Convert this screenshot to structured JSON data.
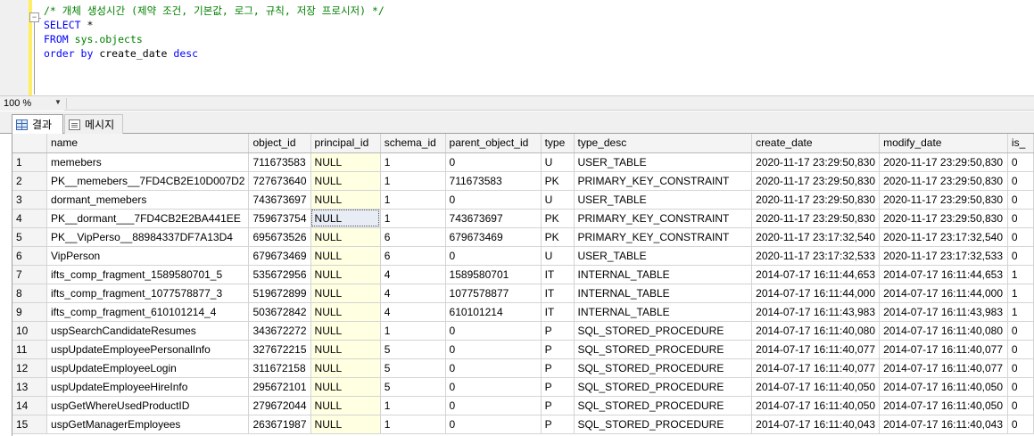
{
  "editor": {
    "lines": [
      {
        "parts": [
          {
            "cls": "c-comment",
            "text": "/* 개체 생성시간 (제약 조건, 기본값, 로그, 규칙, 저장 프로시저) */"
          }
        ]
      },
      {
        "parts": [
          {
            "cls": "c-kw",
            "text": "SELECT"
          },
          {
            "cls": "c-id",
            "text": " *"
          }
        ]
      },
      {
        "parts": [
          {
            "cls": "c-kw",
            "text": "FROM"
          },
          {
            "cls": "c-id",
            "text": " "
          },
          {
            "cls": "c-obj",
            "text": "sys.objects"
          }
        ]
      },
      {
        "parts": [
          {
            "cls": "c-kw",
            "text": "order by"
          },
          {
            "cls": "c-id",
            "text": " create_date "
          },
          {
            "cls": "c-kw",
            "text": "desc"
          }
        ]
      }
    ]
  },
  "zoom": {
    "value": "100 %"
  },
  "tabs": {
    "results_label": "결과",
    "messages_label": "메시지"
  },
  "grid": {
    "columns": [
      "name",
      "object_id",
      "principal_id",
      "schema_id",
      "parent_object_id",
      "type",
      "type_desc",
      "create_date",
      "modify_date",
      "is_"
    ],
    "rows": [
      [
        "1",
        "memebers",
        "711673583",
        "NULL",
        "1",
        "0",
        "U",
        "USER_TABLE",
        "2020-11-17 23:29:50,830",
        "2020-11-17 23:29:50,830",
        "0"
      ],
      [
        "2",
        "PK__memebers__7FD4CB2E10D007D2",
        "727673640",
        "NULL",
        "1",
        "711673583",
        "PK",
        "PRIMARY_KEY_CONSTRAINT",
        "2020-11-17 23:29:50,830",
        "2020-11-17 23:29:50,830",
        "0"
      ],
      [
        "3",
        "dormant_memebers",
        "743673697",
        "NULL",
        "1",
        "0",
        "U",
        "USER_TABLE",
        "2020-11-17 23:29:50,830",
        "2020-11-17 23:29:50,830",
        "0"
      ],
      [
        "4",
        "PK__dormant___7FD4CB2E2BA441EE",
        "759673754",
        "NULL",
        "1",
        "743673697",
        "PK",
        "PRIMARY_KEY_CONSTRAINT",
        "2020-11-17 23:29:50,830",
        "2020-11-17 23:29:50,830",
        "0"
      ],
      [
        "5",
        "PK__VipPerso__88984337DF7A13D4",
        "695673526",
        "NULL",
        "6",
        "679673469",
        "PK",
        "PRIMARY_KEY_CONSTRAINT",
        "2020-11-17 23:17:32,540",
        "2020-11-17 23:17:32,540",
        "0"
      ],
      [
        "6",
        "VipPerson",
        "679673469",
        "NULL",
        "6",
        "0",
        "U",
        "USER_TABLE",
        "2020-11-17 23:17:32,533",
        "2020-11-17 23:17:32,533",
        "0"
      ],
      [
        "7",
        "ifts_comp_fragment_1589580701_5",
        "535672956",
        "NULL",
        "4",
        "1589580701",
        "IT",
        "INTERNAL_TABLE",
        "2014-07-17 16:11:44,653",
        "2014-07-17 16:11:44,653",
        "1"
      ],
      [
        "8",
        "ifts_comp_fragment_1077578877_3",
        "519672899",
        "NULL",
        "4",
        "1077578877",
        "IT",
        "INTERNAL_TABLE",
        "2014-07-17 16:11:44,000",
        "2014-07-17 16:11:44,000",
        "1"
      ],
      [
        "9",
        "ifts_comp_fragment_610101214_4",
        "503672842",
        "NULL",
        "4",
        "610101214",
        "IT",
        "INTERNAL_TABLE",
        "2014-07-17 16:11:43,983",
        "2014-07-17 16:11:43,983",
        "1"
      ],
      [
        "10",
        "uspSearchCandidateResumes",
        "343672272",
        "NULL",
        "1",
        "0",
        "P",
        "SQL_STORED_PROCEDURE",
        "2014-07-17 16:11:40,080",
        "2014-07-17 16:11:40,080",
        "0"
      ],
      [
        "11",
        "uspUpdateEmployeePersonalInfo",
        "327672215",
        "NULL",
        "5",
        "0",
        "P",
        "SQL_STORED_PROCEDURE",
        "2014-07-17 16:11:40,077",
        "2014-07-17 16:11:40,077",
        "0"
      ],
      [
        "12",
        "uspUpdateEmployeeLogin",
        "311672158",
        "NULL",
        "5",
        "0",
        "P",
        "SQL_STORED_PROCEDURE",
        "2014-07-17 16:11:40,077",
        "2014-07-17 16:11:40,077",
        "0"
      ],
      [
        "13",
        "uspUpdateEmployeeHireInfo",
        "295672101",
        "NULL",
        "5",
        "0",
        "P",
        "SQL_STORED_PROCEDURE",
        "2014-07-17 16:11:40,050",
        "2014-07-17 16:11:40,050",
        "0"
      ],
      [
        "14",
        "uspGetWhereUsedProductID",
        "279672044",
        "NULL",
        "1",
        "0",
        "P",
        "SQL_STORED_PROCEDURE",
        "2014-07-17 16:11:40,050",
        "2014-07-17 16:11:40,050",
        "0"
      ],
      [
        "15",
        "uspGetManagerEmployees",
        "263671987",
        "NULL",
        "1",
        "0",
        "P",
        "SQL_STORED_PROCEDURE",
        "2014-07-17 16:11:40,043",
        "2014-07-17 16:11:40,043",
        "0"
      ]
    ],
    "selected_cell": {
      "row": 3,
      "column": "principal_id"
    }
  }
}
